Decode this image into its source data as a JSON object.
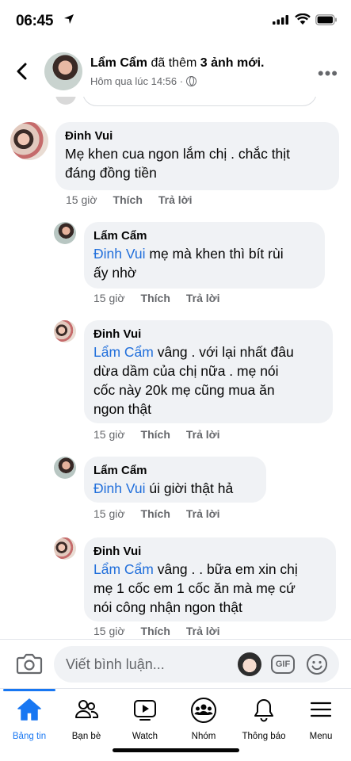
{
  "status_bar": {
    "time": "06:45"
  },
  "post_header": {
    "author": "Lẩm Cẩm",
    "action_pre": "đã thêm",
    "action_count": "3 ảnh mới.",
    "time": "Hôm qua lúc 14:56 ·"
  },
  "comments": [
    {
      "author": "Đinh Vui",
      "mention": "",
      "lines": [
        "Mẹ khen cua ngon lắm chị . chắc thịt",
        "đáng đồng tiền"
      ],
      "time": "15 giờ",
      "like": "Thích",
      "reply": "Trả lời"
    },
    {
      "author": "Lẩm Cẩm",
      "mention": "Đinh Vui",
      "lines": [
        " mẹ mà khen thì bít rùi",
        "ấy nhờ"
      ],
      "time": "15 giờ",
      "like": "Thích",
      "reply": "Trả lời"
    },
    {
      "author": "Đinh Vui",
      "mention": "Lẩm Cẩm",
      "lines": [
        " vâng . với lại nhất đâu",
        "dừa dầm của chị nữa . mẹ nói",
        "cốc này 20k mẹ cũng mua ăn",
        "ngon thật"
      ],
      "time": "15 giờ",
      "like": "Thích",
      "reply": "Trả lời"
    },
    {
      "author": "Lẩm Cẩm",
      "mention": "Đinh Vui",
      "lines": [
        " úi giời thật hả"
      ],
      "time": "15 giờ",
      "like": "Thích",
      "reply": "Trả lời"
    },
    {
      "author": "Đinh Vui",
      "mention": "Lẩm Cẩm",
      "lines": [
        " vâng . . bữa em xin chị",
        "mẹ 1 cốc em 1 cốc ăn mà mẹ cứ",
        "nói công nhận ngon thật"
      ],
      "time": "15 giờ",
      "like": "Thích",
      "reply": "Trả lời"
    }
  ],
  "composer": {
    "placeholder": "Viết bình luận...",
    "gif_label": "GIF"
  },
  "bottom_nav": {
    "accent": "#1877f2",
    "items": [
      {
        "label": "Bảng tin",
        "icon": "home-icon",
        "active": true
      },
      {
        "label": "Bạn bè",
        "icon": "friends-icon",
        "active": false
      },
      {
        "label": "Watch",
        "icon": "watch-icon",
        "active": false
      },
      {
        "label": "Nhóm",
        "icon": "groups-icon",
        "active": false
      },
      {
        "label": "Thông báo",
        "icon": "bell-icon",
        "active": false
      },
      {
        "label": "Menu",
        "icon": "menu-icon",
        "active": false
      }
    ]
  }
}
